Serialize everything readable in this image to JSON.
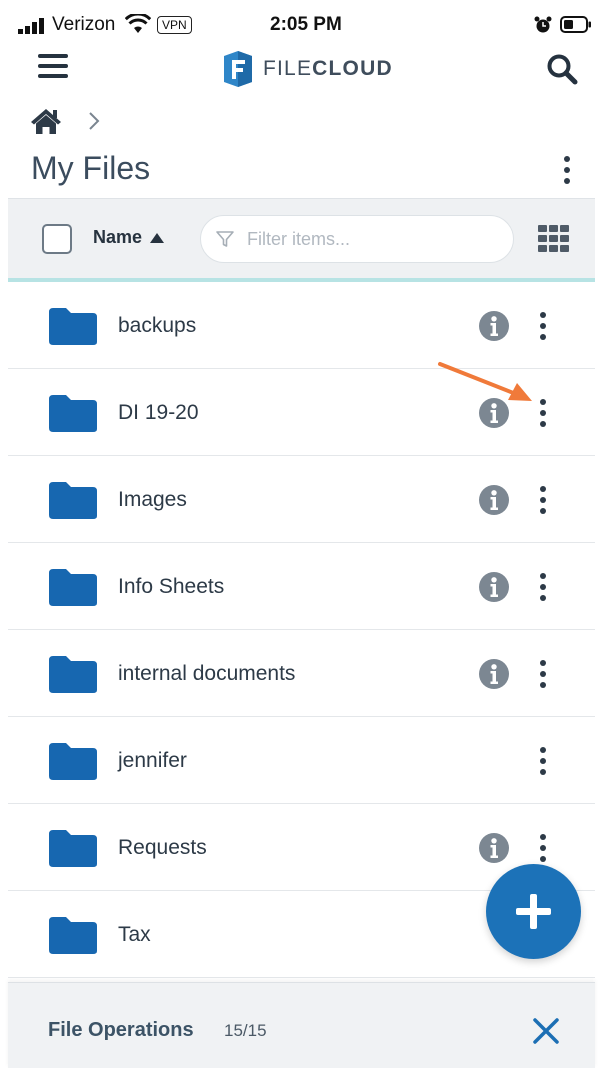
{
  "status_bar": {
    "carrier": "Verizon",
    "vpn": "VPN",
    "time": "2:05 PM"
  },
  "header": {
    "logo_text_light": "FILE",
    "logo_text_bold": "CLOUD",
    "icons": [
      "menu-icon",
      "filecloud-logo",
      "search-icon"
    ]
  },
  "breadcrumb": {
    "icons": [
      "home-icon",
      "chevron-right-icon"
    ]
  },
  "page": {
    "title": "My Files"
  },
  "toolbar": {
    "sort_label": "Name",
    "filter_placeholder": "Filter items..."
  },
  "files": [
    {
      "name": "backups",
      "has_info": true
    },
    {
      "name": "DI 19-20",
      "has_info": true
    },
    {
      "name": "Images",
      "has_info": true
    },
    {
      "name": "Info Sheets",
      "has_info": true
    },
    {
      "name": "internal documents",
      "has_info": true
    },
    {
      "name": "jennifer",
      "has_info": false
    },
    {
      "name": "Requests",
      "has_info": true
    },
    {
      "name": "Tax",
      "has_info": false
    }
  ],
  "bottom_panel": {
    "title": "File Operations",
    "count": "15/15"
  },
  "colors": {
    "brand_blue": "#1c72b8",
    "folder_blue": "#1767b0",
    "accent_teal": "#b7e3e4",
    "annotation_orange": "#f07a3a"
  }
}
